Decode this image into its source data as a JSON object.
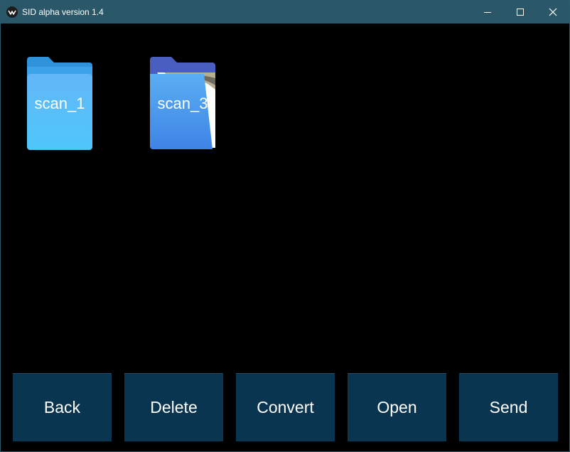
{
  "window": {
    "title": "SID alpha version 1.4",
    "colors": {
      "titlebar": "#2b5868",
      "background": "#000000",
      "button": "#0a3550",
      "folder_light": "#4cc3f7",
      "folder_dark": "#3c8de8"
    }
  },
  "folders": [
    {
      "label": "scan_1",
      "icon": "folder-icon"
    },
    {
      "label": "scan_3",
      "icon": "folder-with-image-icon"
    }
  ],
  "actions": {
    "back": "Back",
    "delete": "Delete",
    "convert": "Convert",
    "open": "Open",
    "send": "Send"
  }
}
